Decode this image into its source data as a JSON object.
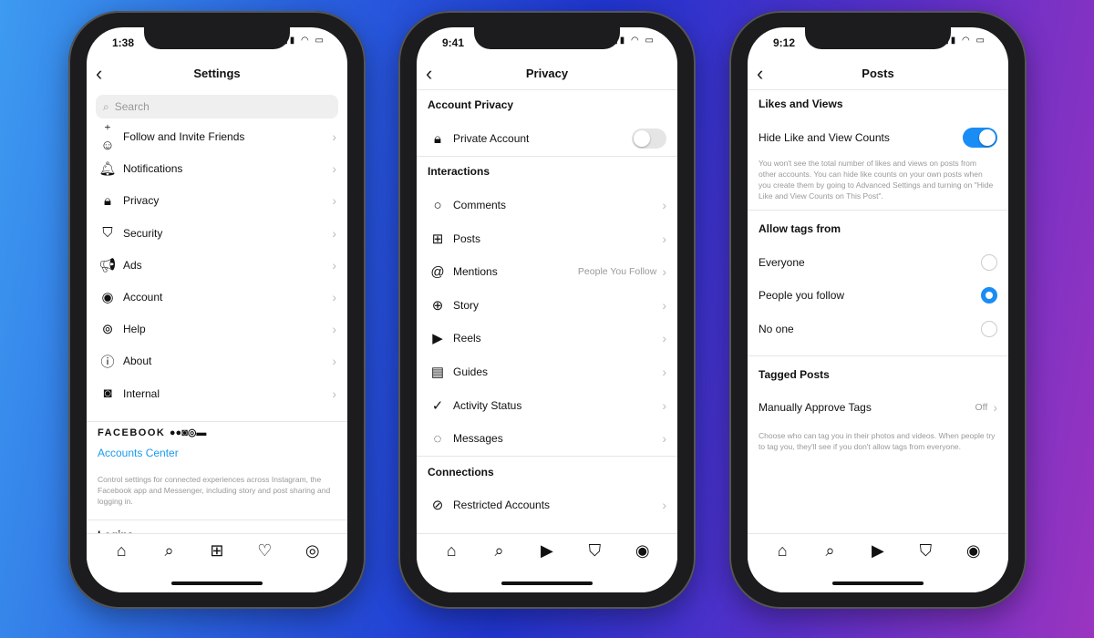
{
  "colors": {
    "accent": "#1a8cf5",
    "link": "#1a9bf0"
  },
  "settings": {
    "time": "1:38",
    "title": "Settings",
    "search_placeholder": "Search",
    "items": [
      {
        "icon": "add-person-icon",
        "label": "Follow and Invite Friends"
      },
      {
        "icon": "bell-icon",
        "label": "Notifications"
      },
      {
        "icon": "lock-icon",
        "label": "Privacy"
      },
      {
        "icon": "shield-icon",
        "label": "Security"
      },
      {
        "icon": "megaphone-icon",
        "label": "Ads"
      },
      {
        "icon": "person-circle-icon",
        "label": "Account"
      },
      {
        "icon": "lifebuoy-icon",
        "label": "Help"
      },
      {
        "icon": "info-icon",
        "label": "About"
      },
      {
        "icon": "instagram-icon",
        "label": "Internal"
      }
    ],
    "facebook_label": "FACEBOOK",
    "accounts_center": "Accounts Center",
    "accounts_desc": "Control settings for connected experiences across Instagram, the Facebook app and Messenger, including story and post sharing and logging in.",
    "logins": "Logins"
  },
  "privacy": {
    "time": "9:41",
    "title": "Privacy",
    "account_privacy": "Account Privacy",
    "private_account": "Private Account",
    "private_on": false,
    "interactions": "Interactions",
    "items": [
      {
        "icon": "comment-icon",
        "label": "Comments",
        "value": ""
      },
      {
        "icon": "plus-square-icon",
        "label": "Posts",
        "value": ""
      },
      {
        "icon": "at-icon",
        "label": "Mentions",
        "value": "People You Follow"
      },
      {
        "icon": "story-plus-icon",
        "label": "Story",
        "value": ""
      },
      {
        "icon": "reels-icon",
        "label": "Reels",
        "value": ""
      },
      {
        "icon": "guides-icon",
        "label": "Guides",
        "value": ""
      },
      {
        "icon": "activity-icon",
        "label": "Activity Status",
        "value": ""
      },
      {
        "icon": "messenger-icon",
        "label": "Messages",
        "value": ""
      }
    ],
    "connections": "Connections",
    "restricted": "Restricted Accounts"
  },
  "posts": {
    "time": "9:12",
    "title": "Posts",
    "likes_views": "Likes and Views",
    "hide_counts": "Hide Like and View Counts",
    "hide_on": true,
    "hide_desc": "You won't see the total number of likes and views on posts from other accounts. You can hide like counts on your own posts when you create them by going to Advanced Settings and turning on \"Hide Like and View Counts on This Post\".",
    "allow_tags": "Allow tags from",
    "tag_options": [
      {
        "label": "Everyone",
        "selected": false
      },
      {
        "label": "People you follow",
        "selected": true
      },
      {
        "label": "No one",
        "selected": false
      }
    ],
    "tagged_posts": "Tagged Posts",
    "manual_approve": "Manually Approve Tags",
    "manual_value": "Off",
    "tag_desc": "Choose who can tag you in their photos and videos. When people try to tag you, they'll see if you don't allow tags from everyone."
  }
}
